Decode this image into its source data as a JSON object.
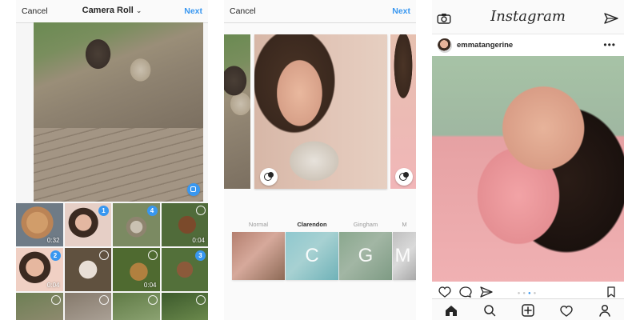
{
  "screen_1": {
    "topbar": {
      "cancel_label": "Cancel",
      "title": "Camera Roll",
      "title_icon": "chevron-down-icon",
      "next_label": "Next"
    },
    "grid": [
      {
        "kind": "photo",
        "duration": "0:32",
        "selected": false
      },
      {
        "kind": "photo",
        "badge": "1",
        "selected": true
      },
      {
        "kind": "photo",
        "badge": "4",
        "selected": true
      },
      {
        "kind": "photo",
        "duration": "0:04",
        "selected": false
      },
      {
        "kind": "photo",
        "badge": "2",
        "duration": "0:04",
        "selected": true
      },
      {
        "kind": "photo",
        "selected": false
      },
      {
        "kind": "photo",
        "duration": "0:04",
        "selected": false
      },
      {
        "kind": "photo",
        "badge": "3",
        "selected": true
      },
      {
        "kind": "photo",
        "selected": false
      },
      {
        "kind": "photo",
        "selected": false
      },
      {
        "kind": "photo",
        "selected": false
      },
      {
        "kind": "photo",
        "selected": false
      }
    ]
  },
  "screen_2": {
    "topbar": {
      "cancel_label": "Cancel",
      "next_label": "Next"
    },
    "filters": [
      {
        "name": "Normal",
        "selected": false,
        "letter": ""
      },
      {
        "name": "Clarendon",
        "selected": true,
        "letter": "C"
      },
      {
        "name": "Gingham",
        "selected": false,
        "letter": "G"
      },
      {
        "name": "M",
        "selected": false,
        "letter": "M"
      }
    ]
  },
  "screen_3": {
    "header": {
      "app_name": "Instagram",
      "left_icon": "camera-icon",
      "right_icon": "send-icon"
    },
    "post": {
      "username": "emmatangerine",
      "more_label": "•••",
      "carousel_dots_count": 4,
      "carousel_active_index": 2
    },
    "actions": {
      "like_icon": "heart-icon",
      "comment_icon": "comment-icon",
      "share_icon": "send-icon",
      "save_icon": "bookmark-icon"
    },
    "tabbar": {
      "items": [
        "home-icon",
        "search-icon",
        "new-post-icon",
        "activity-icon",
        "profile-icon"
      ]
    }
  }
}
